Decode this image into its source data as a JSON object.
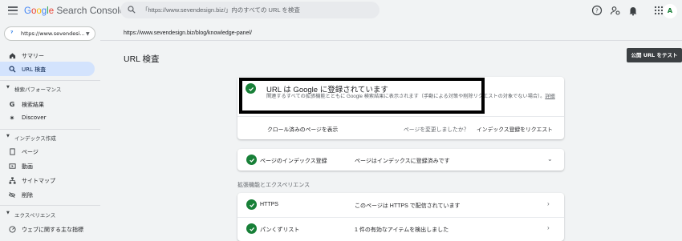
{
  "header": {
    "logo_google": "Google",
    "logo_product": "Search Console",
    "search_placeholder": "「https://www.sevendesign.biz/」内のすべての URL を検査",
    "avatar_letter": "A"
  },
  "sidebar": {
    "property": "https://www.sevendesi...",
    "items_top": [
      {
        "label": "サマリー",
        "icon": "home-icon"
      },
      {
        "label": "URL 検査",
        "icon": "search-icon",
        "active": true
      }
    ],
    "section_performance": "検索パフォーマンス",
    "performance_items": [
      {
        "label": "検索結果",
        "icon": "google-g-icon"
      },
      {
        "label": "Discover",
        "icon": "discover-icon"
      }
    ],
    "section_index": "インデックス作成",
    "index_items": [
      {
        "label": "ページ",
        "icon": "page-icon"
      },
      {
        "label": "動画",
        "icon": "video-icon"
      },
      {
        "label": "サイトマップ",
        "icon": "sitemap-icon"
      },
      {
        "label": "削除",
        "icon": "removal-icon"
      }
    ],
    "section_experience": "エクスペリエンス",
    "experience_items": [
      {
        "label": "ウェブに関する主な指標",
        "icon": "vitals-icon"
      }
    ]
  },
  "main": {
    "inspected_url": "https://www.sevendesign.biz/blog/knowledge-panel/",
    "page_title": "URL 検査",
    "live_test_button": "公開 URL をテスト",
    "status_title": "URL は Google に登録されています",
    "status_desc": "関連するすべての拡張機能とともに Google 検索結果に表示されます（手動による対策や削除リクエストの対象でない場合）。",
    "status_link": "詳細",
    "view_crawled": "クロール済みのページを表示",
    "changed_question": "ページを変更しましたか？",
    "request_indexing": "インデックス登録をリクエスト",
    "index_row": {
      "label": "ページのインデックス登録",
      "value": "ページはインデックスに登録済みです"
    },
    "enhancements_label": "拡張機能とエクスペリエンス",
    "enhancement_rows": [
      {
        "label": "HTTPS",
        "value": "このページは HTTPS で配信されています"
      },
      {
        "label": "パンくずリスト",
        "value": "1 件の有効なアイテムを検出しました"
      }
    ]
  },
  "colors": {
    "accent": "#1a73e8",
    "success": "#188038",
    "active_nav": "#d3e3fd"
  }
}
